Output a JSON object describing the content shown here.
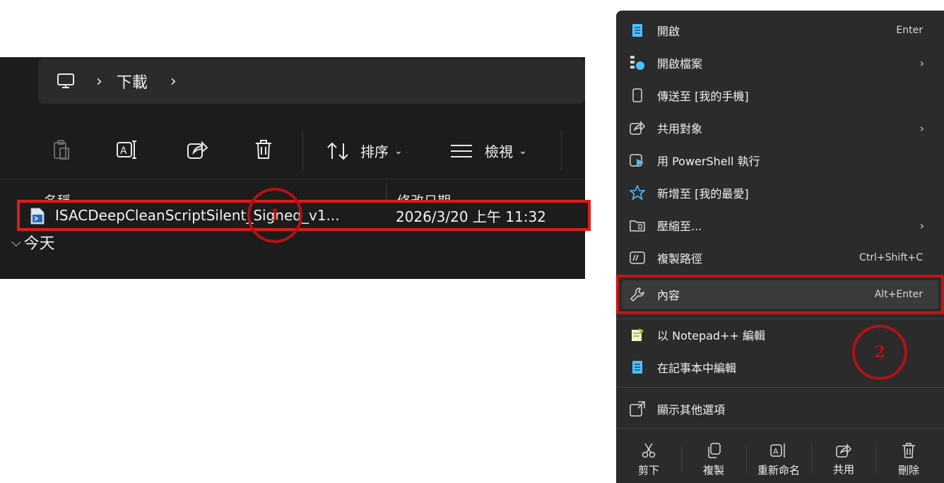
{
  "explorer": {
    "breadcrumb": {
      "crumb": "下載",
      "separator": "›"
    },
    "toolbar": {
      "sort_label": "排序",
      "view_label": "檢視",
      "dropdown": "⌄"
    },
    "columns": {
      "name": "名稱",
      "modified": "修改日期"
    },
    "group_label": "今天",
    "group_chevron": "⌵",
    "file": {
      "name": "ISACDeepCleanScriptSilent_Signed_v1...",
      "modified": "2026/3/20 上午 11:32"
    }
  },
  "badges": {
    "one": "1",
    "two": "2"
  },
  "context_menu": {
    "items": [
      {
        "label": "開啟",
        "shortcut": "Enter"
      },
      {
        "label": "開啟檔案",
        "chevron": "›"
      },
      {
        "label": "傳送至 [我的手機]"
      },
      {
        "label": "共用對象",
        "chevron": "›"
      },
      {
        "label": "用 PowerShell 執行"
      },
      {
        "label": "新增至 [我的最愛]"
      },
      {
        "label": "壓縮至...",
        "chevron": "›"
      },
      {
        "label": "複製路徑",
        "shortcut": "Ctrl+Shift+C"
      },
      {
        "label": "內容",
        "shortcut": "Alt+Enter"
      },
      {
        "label": "以 Notepad++ 編輯"
      },
      {
        "label": "在記事本中編輯"
      },
      {
        "label": "顯示其他選項"
      }
    ],
    "bottom_actions": [
      {
        "label": "剪下"
      },
      {
        "label": "複製"
      },
      {
        "label": "重新命名"
      },
      {
        "label": "共用"
      },
      {
        "label": "刪除"
      }
    ]
  },
  "colors": {
    "highlight_red": "#e01a1a",
    "badge_red": "#b31212",
    "accent_blue": "#4cc2ff",
    "panel_dark": "#1c1c1c",
    "menu_bg": "#2b2b2b"
  }
}
